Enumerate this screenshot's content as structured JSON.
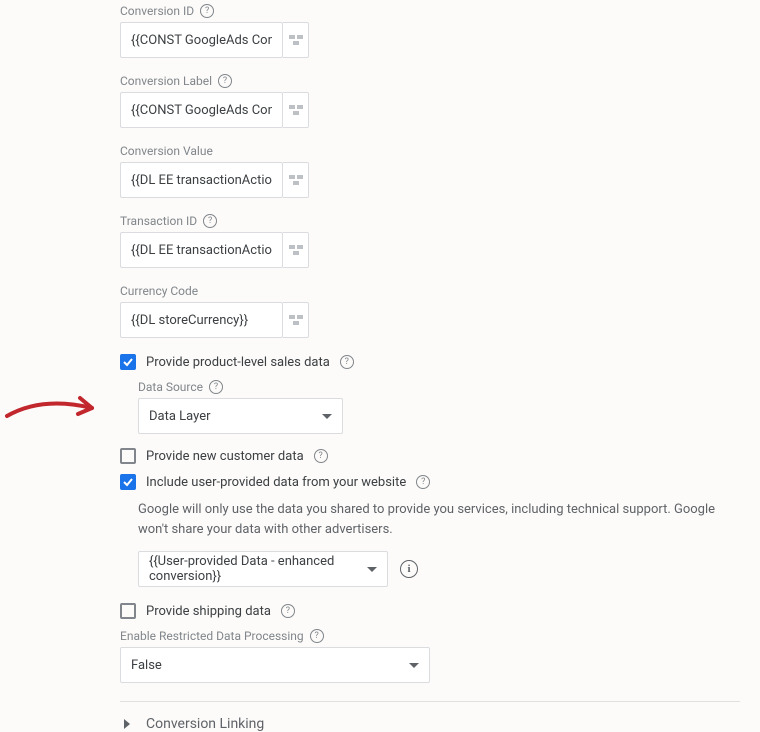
{
  "fields": {
    "conversionId": {
      "label": "Conversion ID",
      "value": "{{CONST GoogleAds Conversion"
    },
    "conversionLabel": {
      "label": "Conversion Label",
      "value": "{{CONST GoogleAds Conversion"
    },
    "conversionValue": {
      "label": "Conversion Value",
      "value": "{{DL EE transactionActionField.re"
    },
    "transactionId": {
      "label": "Transaction ID",
      "value": "{{DL EE transactionActionField.id"
    },
    "currencyCode": {
      "label": "Currency Code",
      "value": "{{DL storeCurrency}}"
    }
  },
  "productLevel": {
    "label": "Provide product-level sales data",
    "checked": true,
    "dataSourceLabel": "Data Source",
    "dataSourceValue": "Data Layer"
  },
  "newCustomer": {
    "label": "Provide new customer data",
    "checked": false
  },
  "userProvided": {
    "label": "Include user-provided data from your website",
    "checked": true,
    "description": "Google will only use the data you shared to provide you services, including technical support. Google won't share your data with other advertisers.",
    "selectValue": "{{User-provided Data - enhanced conversion}}"
  },
  "shipping": {
    "label": "Provide shipping data",
    "checked": false
  },
  "restricted": {
    "label": "Enable Restricted Data Processing",
    "value": "False"
  },
  "conversionLinking": {
    "label": "Conversion Linking"
  },
  "icons": {
    "help": "?",
    "info": "i"
  }
}
